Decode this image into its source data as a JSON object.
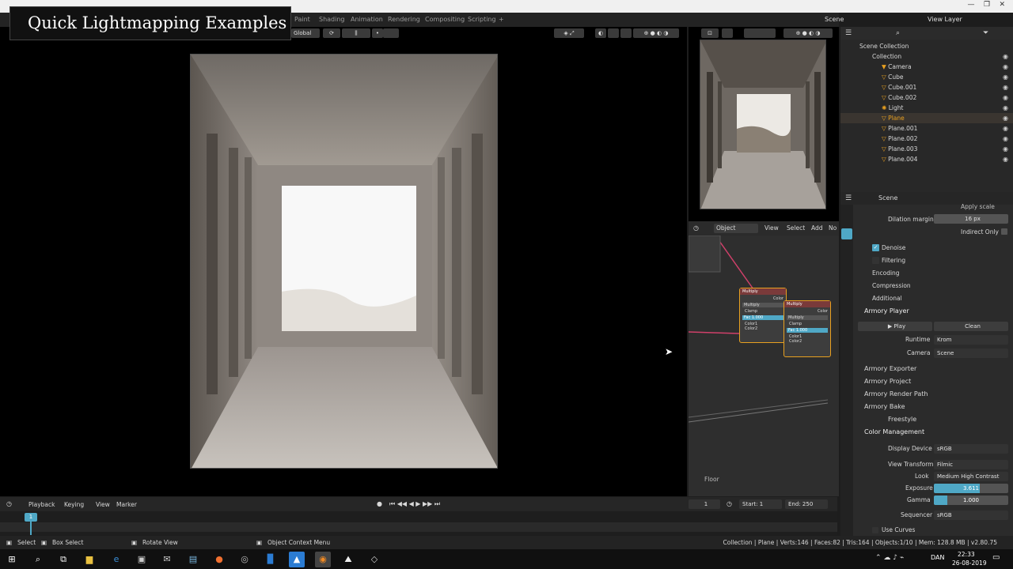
{
  "overlay": {
    "title": "Quick Lightmapping Examples"
  },
  "menubar": {
    "tabs": [
      "Paint",
      "Shading",
      "Animation",
      "Rendering",
      "Compositing",
      "Scripting",
      "+"
    ],
    "scene_label": "Scene",
    "view_layer_label": "View Layer"
  },
  "viewport": {
    "transform_orientation": "Global"
  },
  "node_editor": {
    "header": {
      "mode": "Object",
      "menus": [
        "View",
        "Select",
        "Add",
        "No"
      ]
    },
    "node1": {
      "title": "Multiply",
      "out": "Color",
      "op": "Multiply",
      "clamp": "Clamp",
      "fac_label": "Fac",
      "fac": "1.000",
      "c1": "Color1",
      "c2": "Color2"
    },
    "node2": {
      "title": "Multiply",
      "out": "Color",
      "op": "Multiply",
      "clamp": "Clamp",
      "fac_label": "Fac",
      "fac": "1.000",
      "c1": "Color1",
      "c2": "Color2"
    },
    "floor_label": "Floor"
  },
  "outliner": {
    "root": "Scene Collection",
    "collection": "Collection",
    "items": [
      "Camera",
      "Cube",
      "Cube.001",
      "Cube.002",
      "Light",
      "Plane",
      "Plane.001",
      "Plane.002",
      "Plane.003",
      "Plane.004"
    ]
  },
  "properties": {
    "header": "Scene",
    "apply_scale": "Apply scale",
    "dilation_label": "Dilation margin",
    "dilation_value": "16 px",
    "indirect_only": "Indirect Only",
    "denoise": "Denoise",
    "filtering": "Filtering",
    "encoding": "Encoding",
    "compression": "Compression",
    "additional": "Additional",
    "armory_player": "Armory Player",
    "play": "Play",
    "clean": "Clean",
    "runtime_label": "Runtime",
    "runtime_value": "Krom",
    "camera_label": "Camera",
    "camera_value": "Scene",
    "armory_exporter": "Armory Exporter",
    "armory_project": "Armory Project",
    "armory_render_path": "Armory Render Path",
    "armory_bake": "Armory Bake",
    "freestyle": "Freestyle",
    "color_management": "Color Management",
    "display_device_label": "Display Device",
    "display_device_value": "sRGB",
    "view_transform_label": "View Transform",
    "view_transform_value": "Filmic",
    "look_label": "Look",
    "look_value": "Medium High Contrast",
    "exposure_label": "Exposure",
    "exposure_value": "3.611",
    "exposure_fill": 0.62,
    "gamma_label": "Gamma",
    "gamma_value": "1.000",
    "gamma_fill": 0.18,
    "sequencer_label": "Sequencer",
    "sequencer_value": "sRGB",
    "use_curves": "Use Curves"
  },
  "timeline": {
    "menus": [
      "Playback",
      "Keying",
      "View",
      "Marker"
    ],
    "current_frame": "1",
    "start_label": "Start:",
    "start_value": "1",
    "end_label": "End:",
    "end_value": "250",
    "playhead": "1"
  },
  "statusbar": {
    "select": "Select",
    "box_select": "Box Select",
    "rotate_view": "Rotate View",
    "context_menu": "Object Context Menu",
    "stats": "Collection | Plane | Verts:146 | Faces:82 | Tris:164 | Objects:1/10 | Mem: 128.8 MB | v2.80.75"
  },
  "taskbar": {
    "lang": "DAN",
    "time": "22:33",
    "date": "26-08-2019"
  },
  "colors": {
    "accent": "#4fa8c6",
    "orange": "#e8a020",
    "eye": "#cccccc"
  }
}
